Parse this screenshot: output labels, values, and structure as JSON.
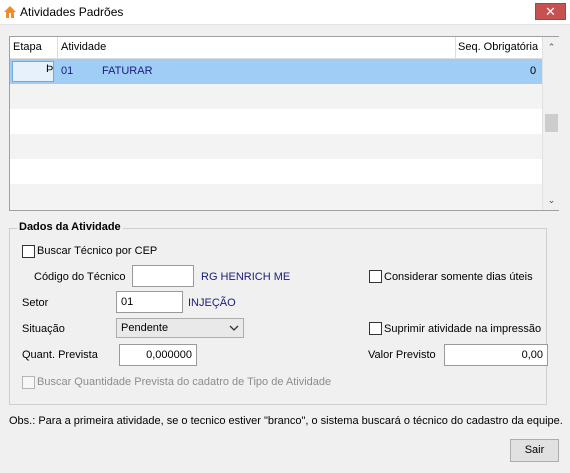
{
  "window": {
    "title": "Atividades Padrões",
    "close_symbol": "✕",
    "icon": "app-home-icon"
  },
  "grid": {
    "columns": [
      "Etapa",
      "Atividade",
      "Seq. Obrigatória"
    ],
    "rows": [
      {
        "etapa": "",
        "codigo": "01",
        "atividade": "FATURAR",
        "seq": "0",
        "selected": true
      }
    ],
    "scroll_up": "⌃",
    "scroll_down": "⌄"
  },
  "dados": {
    "title": "Dados da Atividade",
    "buscar_tecnico_cep": "Buscar Técnico por CEP",
    "codigo_tecnico_label": "Código do Técnico",
    "codigo_tecnico_value": "",
    "tecnico_nome": "RG HENRICH ME",
    "considerar_dias_uteis": "Considerar somente dias úteis",
    "setor_label": "Setor",
    "setor_value": "01",
    "setor_nome": "INJEÇÃO",
    "situacao_label": "Situação",
    "situacao_value": "Pendente",
    "suprimir_label": "Suprimir atividade na impressão",
    "quant_prevista_label": "Quant. Prevista",
    "quant_prevista_value": "0,000000",
    "valor_previsto_label": "Valor Previsto",
    "valor_previsto_value": "0,00",
    "buscar_quantidade": "Buscar Quantidade Prevista do cadatro de Tipo de Atividade"
  },
  "obs": "Obs.: Para a primeira atividade, se o tecnico estiver \"branco\", o sistema buscará o técnico do cadastro da equipe.",
  "buttons": {
    "sair": "Sair"
  }
}
